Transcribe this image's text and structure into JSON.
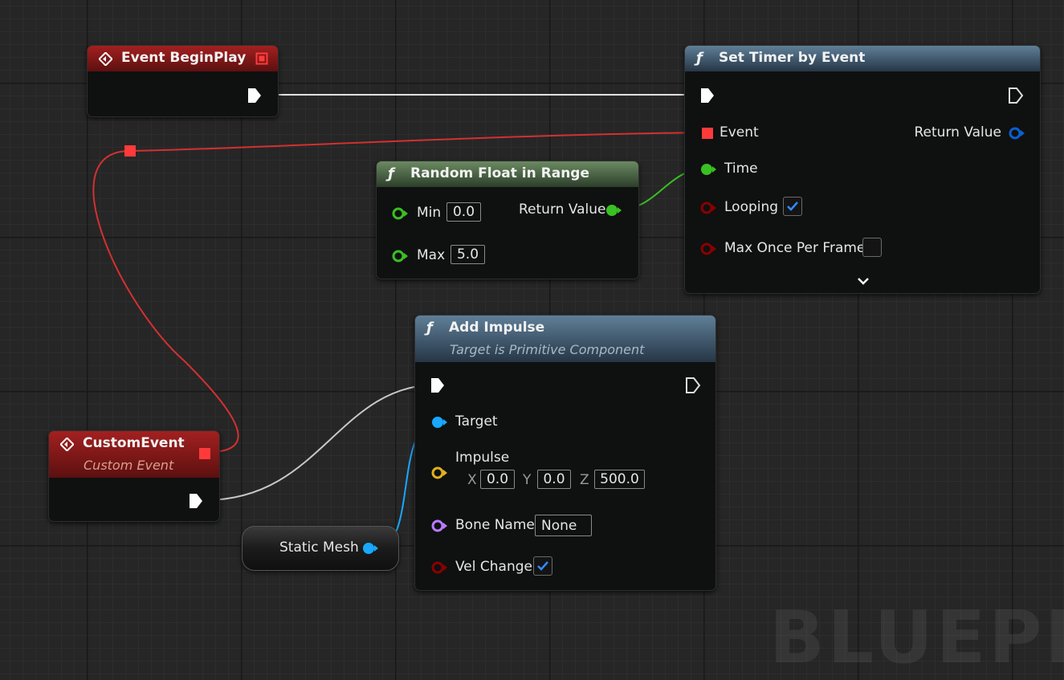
{
  "watermark": "BLUEPRINT",
  "colors": {
    "exec": "#ffffff",
    "delegate": "#ff3a3a",
    "float": "#39c022",
    "bool": "#8a0000",
    "object": "#18a8ff",
    "vector": "#e0b020",
    "name": "#b97bff"
  },
  "nodes": {
    "event_begin_play": {
      "title": "Event BeginPlay",
      "icon": "event-diamond-icon"
    },
    "set_timer": {
      "title": "Set Timer by Event",
      "icon": "function-icon",
      "pins": {
        "event": "Event",
        "return_value": "Return Value",
        "time": "Time",
        "looping": "Looping",
        "max_once": "Max Once Per Frame"
      },
      "looping_checked": true,
      "max_once_checked": false,
      "expand_icon": "chevron-down-icon"
    },
    "random_float": {
      "title": "Random Float in Range",
      "icon": "function-icon",
      "pins": {
        "min": "Min",
        "max": "Max",
        "return_value": "Return Value"
      },
      "min_value": "0.0",
      "max_value": "5.0"
    },
    "add_impulse": {
      "title": "Add Impulse",
      "subtitle": "Target is Primitive Component",
      "icon": "function-icon",
      "pins": {
        "target": "Target",
        "impulse": "Impulse",
        "bone_name": "Bone Name",
        "vel_change": "Vel Change"
      },
      "impulse": {
        "x_label": "X",
        "x": "0.0",
        "y_label": "Y",
        "y": "0.0",
        "z_label": "Z",
        "z": "500.0"
      },
      "bone_name_value": "None",
      "vel_change_checked": true
    },
    "custom_event": {
      "title": "CustomEvent",
      "subtitle": "Custom Event",
      "icon": "event-diamond-icon"
    },
    "static_mesh": {
      "label": "Static Mesh"
    }
  }
}
